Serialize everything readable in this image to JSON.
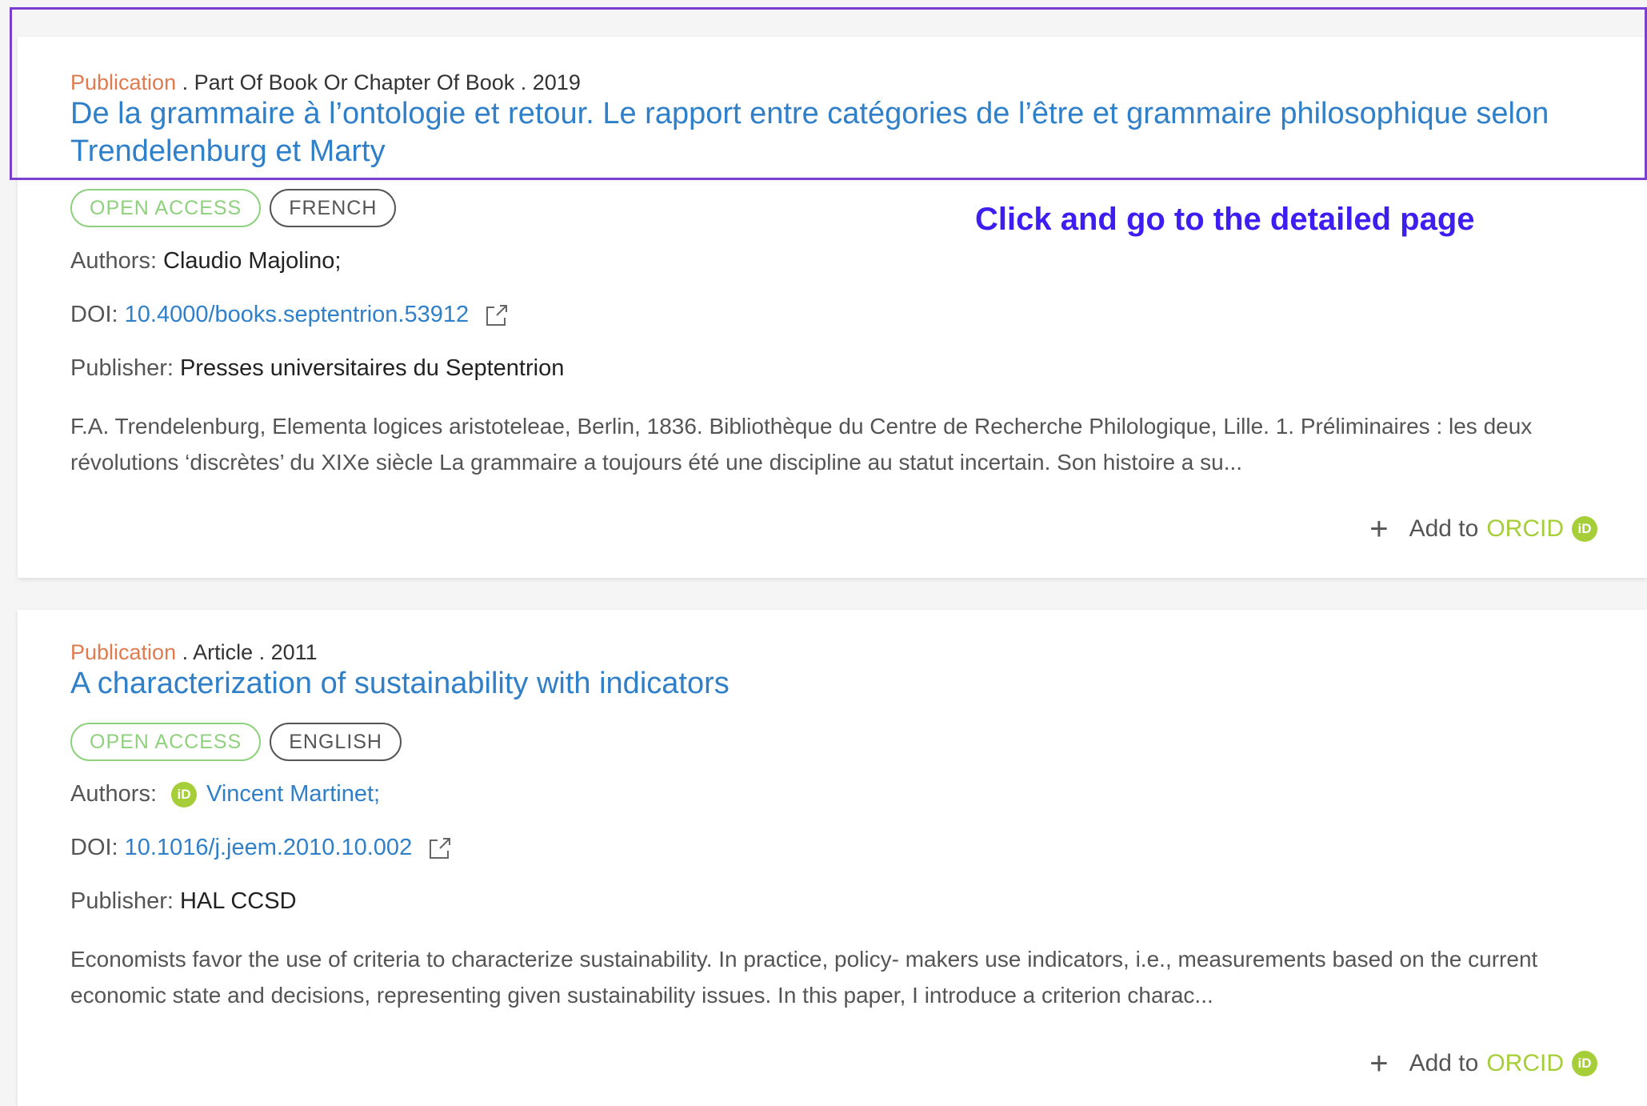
{
  "results": [
    {
      "type": "Publication",
      "meta_rest": " . Part Of Book Or Chapter Of Book . 2019",
      "title": "De la grammaire à l’ontologie et retour. Le rapport entre catégories de l’être et grammaire philosophique selon Trendelenburg et Marty",
      "badges": {
        "access": "OPEN ACCESS",
        "language": "FRENCH"
      },
      "authors_label": "Authors:",
      "authors": "Claudio Majolino;",
      "doi_label": "DOI:",
      "doi": "10.4000/books.septentrion.53912",
      "publisher_label": "Publisher:",
      "publisher": "Presses universitaires du Septentrion",
      "abstract": "F.A. Trendelenburg, Elementa logices aristoteleae, Berlin, 1836. Bibliothèque du Centre de Recherche Philologique, Lille. 1. Préliminaires : les deux révolutions ‘discrètes’ du XIXe siècle La grammaire a toujours été une discipline au statut incertain. Son histoire a su...",
      "add_label": "Add to",
      "orcid_word": "ORCID"
    },
    {
      "type": "Publication",
      "meta_rest": " . Article . 2011",
      "title": "A characterization of sustainability with indicators",
      "badges": {
        "access": "OPEN ACCESS",
        "language": "ENGLISH"
      },
      "authors_label": "Authors:",
      "authors": "Vincent Martinet;",
      "doi_label": "DOI:",
      "doi": "10.1016/j.jeem.2010.10.002",
      "publisher_label": "Publisher:",
      "publisher": "HAL CCSD",
      "abstract": "Economists favor the use of criteria to characterize sustainability. In practice, policy- makers use indicators, i.e., measurements based on the current economic state and decisions, representing given sustainability issues. In this paper, I introduce a criterion charac...",
      "add_label": "Add to",
      "orcid_word": "ORCID"
    }
  ],
  "annotation": "Click and go to the detailed page",
  "orcid_badge_text": "iD",
  "colors": {
    "title_link": "#2f7fc9",
    "type_label": "#e07b4f",
    "open_access": "#8fd17e",
    "orcid_green": "#a6ce39",
    "highlight_border": "#7a3fd0",
    "annotation_text": "#3d1ef0"
  },
  "icons": [
    "external-link-icon",
    "plus-icon",
    "orcid-icon"
  ]
}
